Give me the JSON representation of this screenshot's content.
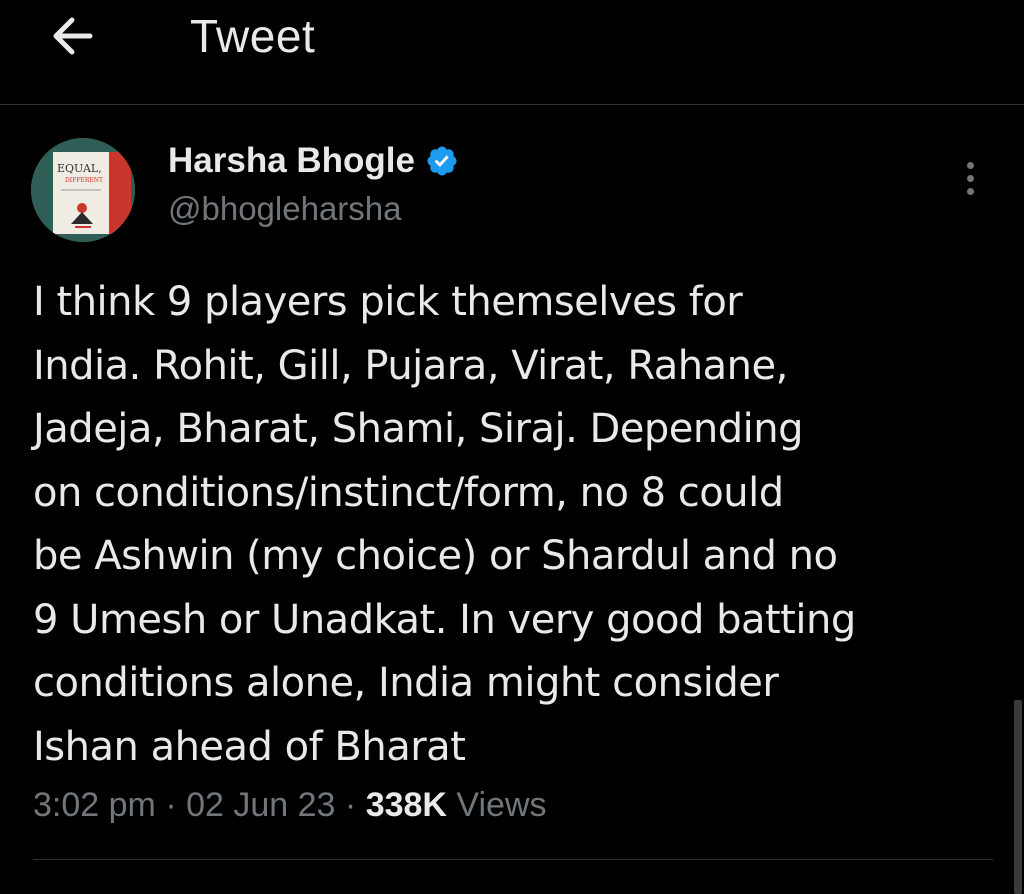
{
  "header": {
    "back_icon": "arrow-left-icon",
    "title": "Tweet"
  },
  "tweet": {
    "author": {
      "name": "Harsha Bhogle",
      "handle": "@bhogleharsha",
      "verified": true,
      "verified_color": "#1d9bf0",
      "avatar_icon": "book-cover-avatar",
      "avatar_text": [
        "EQUAL,",
        "DIFFERENT"
      ]
    },
    "more_icon": "more-vertical-icon",
    "text_lines": [
      "I think 9 players pick themselves for",
      "India. Rohit, Gill, Pujara, Virat, Rahane,",
      "Jadeja, Bharat, Shami, Siraj. Depending",
      "on conditions/instinct/form, no 8 could",
      "be Ashwin (my choice) or Shardul and no",
      "9 Umesh or Unadkat. In very good batting",
      "conditions alone, India might consider",
      "Ishan ahead of Bharat"
    ],
    "time": "3:02 pm",
    "separator": "·",
    "date": "02 Jun 23",
    "views_count": "338K",
    "views_label": "Views"
  },
  "colors": {
    "background": "#000000",
    "text_primary": "#e7e9ea",
    "text_secondary": "#71767b",
    "divider": "#2f3336"
  }
}
